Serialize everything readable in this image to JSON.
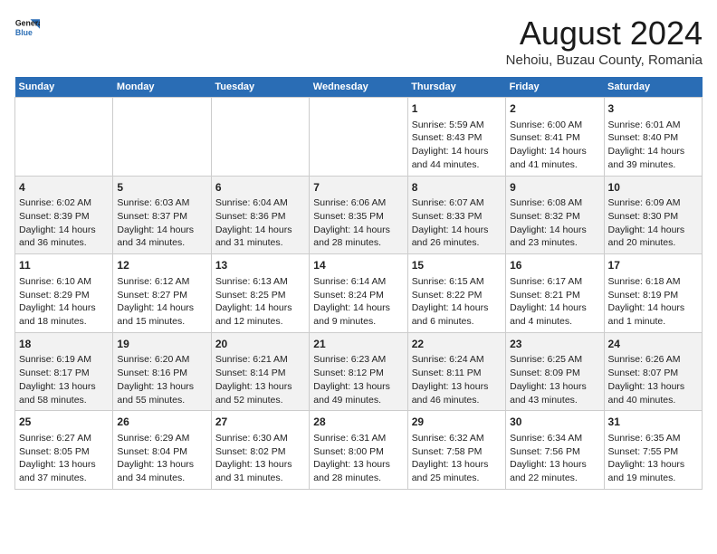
{
  "logo": {
    "line1": "General",
    "line2": "Blue"
  },
  "title": "August 2024",
  "subtitle": "Nehoiu, Buzau County, Romania",
  "days_of_week": [
    "Sunday",
    "Monday",
    "Tuesday",
    "Wednesday",
    "Thursday",
    "Friday",
    "Saturday"
  ],
  "weeks": [
    [
      {
        "day": "",
        "info": ""
      },
      {
        "day": "",
        "info": ""
      },
      {
        "day": "",
        "info": ""
      },
      {
        "day": "",
        "info": ""
      },
      {
        "day": "1",
        "sunrise": "Sunrise: 5:59 AM",
        "sunset": "Sunset: 8:43 PM",
        "daylight": "Daylight: 14 hours and 44 minutes."
      },
      {
        "day": "2",
        "sunrise": "Sunrise: 6:00 AM",
        "sunset": "Sunset: 8:41 PM",
        "daylight": "Daylight: 14 hours and 41 minutes."
      },
      {
        "day": "3",
        "sunrise": "Sunrise: 6:01 AM",
        "sunset": "Sunset: 8:40 PM",
        "daylight": "Daylight: 14 hours and 39 minutes."
      }
    ],
    [
      {
        "day": "4",
        "sunrise": "Sunrise: 6:02 AM",
        "sunset": "Sunset: 8:39 PM",
        "daylight": "Daylight: 14 hours and 36 minutes."
      },
      {
        "day": "5",
        "sunrise": "Sunrise: 6:03 AM",
        "sunset": "Sunset: 8:37 PM",
        "daylight": "Daylight: 14 hours and 34 minutes."
      },
      {
        "day": "6",
        "sunrise": "Sunrise: 6:04 AM",
        "sunset": "Sunset: 8:36 PM",
        "daylight": "Daylight: 14 hours and 31 minutes."
      },
      {
        "day": "7",
        "sunrise": "Sunrise: 6:06 AM",
        "sunset": "Sunset: 8:35 PM",
        "daylight": "Daylight: 14 hours and 28 minutes."
      },
      {
        "day": "8",
        "sunrise": "Sunrise: 6:07 AM",
        "sunset": "Sunset: 8:33 PM",
        "daylight": "Daylight: 14 hours and 26 minutes."
      },
      {
        "day": "9",
        "sunrise": "Sunrise: 6:08 AM",
        "sunset": "Sunset: 8:32 PM",
        "daylight": "Daylight: 14 hours and 23 minutes."
      },
      {
        "day": "10",
        "sunrise": "Sunrise: 6:09 AM",
        "sunset": "Sunset: 8:30 PM",
        "daylight": "Daylight: 14 hours and 20 minutes."
      }
    ],
    [
      {
        "day": "11",
        "sunrise": "Sunrise: 6:10 AM",
        "sunset": "Sunset: 8:29 PM",
        "daylight": "Daylight: 14 hours and 18 minutes."
      },
      {
        "day": "12",
        "sunrise": "Sunrise: 6:12 AM",
        "sunset": "Sunset: 8:27 PM",
        "daylight": "Daylight: 14 hours and 15 minutes."
      },
      {
        "day": "13",
        "sunrise": "Sunrise: 6:13 AM",
        "sunset": "Sunset: 8:25 PM",
        "daylight": "Daylight: 14 hours and 12 minutes."
      },
      {
        "day": "14",
        "sunrise": "Sunrise: 6:14 AM",
        "sunset": "Sunset: 8:24 PM",
        "daylight": "Daylight: 14 hours and 9 minutes."
      },
      {
        "day": "15",
        "sunrise": "Sunrise: 6:15 AM",
        "sunset": "Sunset: 8:22 PM",
        "daylight": "Daylight: 14 hours and 6 minutes."
      },
      {
        "day": "16",
        "sunrise": "Sunrise: 6:17 AM",
        "sunset": "Sunset: 8:21 PM",
        "daylight": "Daylight: 14 hours and 4 minutes."
      },
      {
        "day": "17",
        "sunrise": "Sunrise: 6:18 AM",
        "sunset": "Sunset: 8:19 PM",
        "daylight": "Daylight: 14 hours and 1 minute."
      }
    ],
    [
      {
        "day": "18",
        "sunrise": "Sunrise: 6:19 AM",
        "sunset": "Sunset: 8:17 PM",
        "daylight": "Daylight: 13 hours and 58 minutes."
      },
      {
        "day": "19",
        "sunrise": "Sunrise: 6:20 AM",
        "sunset": "Sunset: 8:16 PM",
        "daylight": "Daylight: 13 hours and 55 minutes."
      },
      {
        "day": "20",
        "sunrise": "Sunrise: 6:21 AM",
        "sunset": "Sunset: 8:14 PM",
        "daylight": "Daylight: 13 hours and 52 minutes."
      },
      {
        "day": "21",
        "sunrise": "Sunrise: 6:23 AM",
        "sunset": "Sunset: 8:12 PM",
        "daylight": "Daylight: 13 hours and 49 minutes."
      },
      {
        "day": "22",
        "sunrise": "Sunrise: 6:24 AM",
        "sunset": "Sunset: 8:11 PM",
        "daylight": "Daylight: 13 hours and 46 minutes."
      },
      {
        "day": "23",
        "sunrise": "Sunrise: 6:25 AM",
        "sunset": "Sunset: 8:09 PM",
        "daylight": "Daylight: 13 hours and 43 minutes."
      },
      {
        "day": "24",
        "sunrise": "Sunrise: 6:26 AM",
        "sunset": "Sunset: 8:07 PM",
        "daylight": "Daylight: 13 hours and 40 minutes."
      }
    ],
    [
      {
        "day": "25",
        "sunrise": "Sunrise: 6:27 AM",
        "sunset": "Sunset: 8:05 PM",
        "daylight": "Daylight: 13 hours and 37 minutes."
      },
      {
        "day": "26",
        "sunrise": "Sunrise: 6:29 AM",
        "sunset": "Sunset: 8:04 PM",
        "daylight": "Daylight: 13 hours and 34 minutes."
      },
      {
        "day": "27",
        "sunrise": "Sunrise: 6:30 AM",
        "sunset": "Sunset: 8:02 PM",
        "daylight": "Daylight: 13 hours and 31 minutes."
      },
      {
        "day": "28",
        "sunrise": "Sunrise: 6:31 AM",
        "sunset": "Sunset: 8:00 PM",
        "daylight": "Daylight: 13 hours and 28 minutes."
      },
      {
        "day": "29",
        "sunrise": "Sunrise: 6:32 AM",
        "sunset": "Sunset: 7:58 PM",
        "daylight": "Daylight: 13 hours and 25 minutes."
      },
      {
        "day": "30",
        "sunrise": "Sunrise: 6:34 AM",
        "sunset": "Sunset: 7:56 PM",
        "daylight": "Daylight: 13 hours and 22 minutes."
      },
      {
        "day": "31",
        "sunrise": "Sunrise: 6:35 AM",
        "sunset": "Sunset: 7:55 PM",
        "daylight": "Daylight: 13 hours and 19 minutes."
      }
    ]
  ]
}
